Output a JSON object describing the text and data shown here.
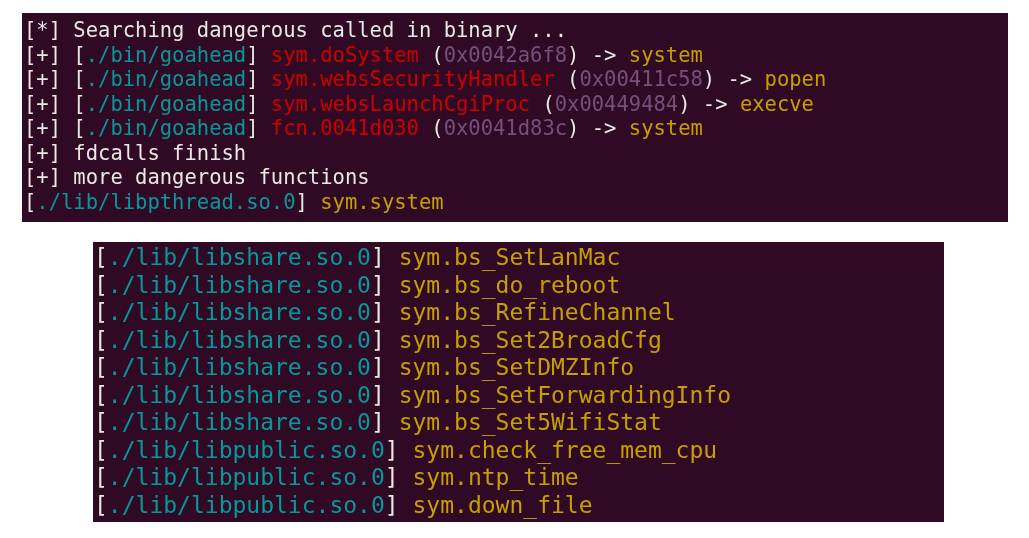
{
  "terminals": [
    {
      "lines": [
        [
          {
            "kind": "plain",
            "text": "[*] Searching dangerous called in binary ..."
          }
        ],
        [
          {
            "kind": "plain",
            "text": "[+] ["
          },
          {
            "kind": "path",
            "text": "./bin/goahead"
          },
          {
            "kind": "plain",
            "text": "] "
          },
          {
            "kind": "func",
            "text": "sym.doSystem"
          },
          {
            "kind": "plain",
            "text": " ("
          },
          {
            "kind": "addr",
            "text": "0x0042a6f8"
          },
          {
            "kind": "plain",
            "text": ") -> "
          },
          {
            "kind": "target",
            "text": "system"
          }
        ],
        [
          {
            "kind": "plain",
            "text": "[+] ["
          },
          {
            "kind": "path",
            "text": "./bin/goahead"
          },
          {
            "kind": "plain",
            "text": "] "
          },
          {
            "kind": "func",
            "text": "sym.websSecurityHandler"
          },
          {
            "kind": "plain",
            "text": " ("
          },
          {
            "kind": "addr",
            "text": "0x00411c58"
          },
          {
            "kind": "plain",
            "text": ") -> "
          },
          {
            "kind": "target",
            "text": "popen"
          }
        ],
        [
          {
            "kind": "plain",
            "text": "[+] ["
          },
          {
            "kind": "path",
            "text": "./bin/goahead"
          },
          {
            "kind": "plain",
            "text": "] "
          },
          {
            "kind": "func",
            "text": "sym.websLaunchCgiProc"
          },
          {
            "kind": "plain",
            "text": " ("
          },
          {
            "kind": "addr",
            "text": "0x00449484"
          },
          {
            "kind": "plain",
            "text": ") -> "
          },
          {
            "kind": "target",
            "text": "execve"
          }
        ],
        [
          {
            "kind": "plain",
            "text": "[+] ["
          },
          {
            "kind": "path",
            "text": "./bin/goahead"
          },
          {
            "kind": "plain",
            "text": "] "
          },
          {
            "kind": "func",
            "text": "fcn.0041d030"
          },
          {
            "kind": "plain",
            "text": " ("
          },
          {
            "kind": "addr",
            "text": "0x0041d83c"
          },
          {
            "kind": "plain",
            "text": ") -> "
          },
          {
            "kind": "target",
            "text": "system"
          }
        ],
        [
          {
            "kind": "plain",
            "text": "[+] fdcalls finish"
          }
        ],
        [
          {
            "kind": "plain",
            "text": "[+] more dangerous functions"
          }
        ],
        [
          {
            "kind": "plain",
            "text": "["
          },
          {
            "kind": "path",
            "text": "./lib/libpthread.so.0"
          },
          {
            "kind": "plain",
            "text": "] "
          },
          {
            "kind": "target",
            "text": "sym.system"
          }
        ]
      ]
    },
    {
      "lines": [
        [
          {
            "kind": "plain",
            "text": "["
          },
          {
            "kind": "path",
            "text": "./lib/libshare.so.0"
          },
          {
            "kind": "plain",
            "text": "] "
          },
          {
            "kind": "target",
            "text": "sym.bs_SetLanMac"
          }
        ],
        [
          {
            "kind": "plain",
            "text": "["
          },
          {
            "kind": "path",
            "text": "./lib/libshare.so.0"
          },
          {
            "kind": "plain",
            "text": "] "
          },
          {
            "kind": "target",
            "text": "sym.bs_do_reboot"
          }
        ],
        [
          {
            "kind": "plain",
            "text": "["
          },
          {
            "kind": "path",
            "text": "./lib/libshare.so.0"
          },
          {
            "kind": "plain",
            "text": "] "
          },
          {
            "kind": "target",
            "text": "sym.bs_RefineChannel"
          }
        ],
        [
          {
            "kind": "plain",
            "text": "["
          },
          {
            "kind": "path",
            "text": "./lib/libshare.so.0"
          },
          {
            "kind": "plain",
            "text": "] "
          },
          {
            "kind": "target",
            "text": "sym.bs_Set2BroadCfg"
          }
        ],
        [
          {
            "kind": "plain",
            "text": "["
          },
          {
            "kind": "path",
            "text": "./lib/libshare.so.0"
          },
          {
            "kind": "plain",
            "text": "] "
          },
          {
            "kind": "target",
            "text": "sym.bs_SetDMZInfo"
          }
        ],
        [
          {
            "kind": "plain",
            "text": "["
          },
          {
            "kind": "path",
            "text": "./lib/libshare.so.0"
          },
          {
            "kind": "plain",
            "text": "] "
          },
          {
            "kind": "target",
            "text": "sym.bs_SetForwardingInfo"
          }
        ],
        [
          {
            "kind": "plain",
            "text": "["
          },
          {
            "kind": "path",
            "text": "./lib/libshare.so.0"
          },
          {
            "kind": "plain",
            "text": "] "
          },
          {
            "kind": "target",
            "text": "sym.bs_Set5WifiStat"
          }
        ],
        [
          {
            "kind": "plain",
            "text": "["
          },
          {
            "kind": "path",
            "text": "./lib/libpublic.so.0"
          },
          {
            "kind": "plain",
            "text": "] "
          },
          {
            "kind": "target",
            "text": "sym.check_free_mem_cpu"
          }
        ],
        [
          {
            "kind": "plain",
            "text": "["
          },
          {
            "kind": "path",
            "text": "./lib/libpublic.so.0"
          },
          {
            "kind": "plain",
            "text": "] "
          },
          {
            "kind": "target",
            "text": "sym.ntp_time"
          }
        ],
        [
          {
            "kind": "plain",
            "text": "["
          },
          {
            "kind": "path",
            "text": "./lib/libpublic.so.0"
          },
          {
            "kind": "plain",
            "text": "] "
          },
          {
            "kind": "target",
            "text": "sym.down_file"
          }
        ]
      ]
    }
  ]
}
